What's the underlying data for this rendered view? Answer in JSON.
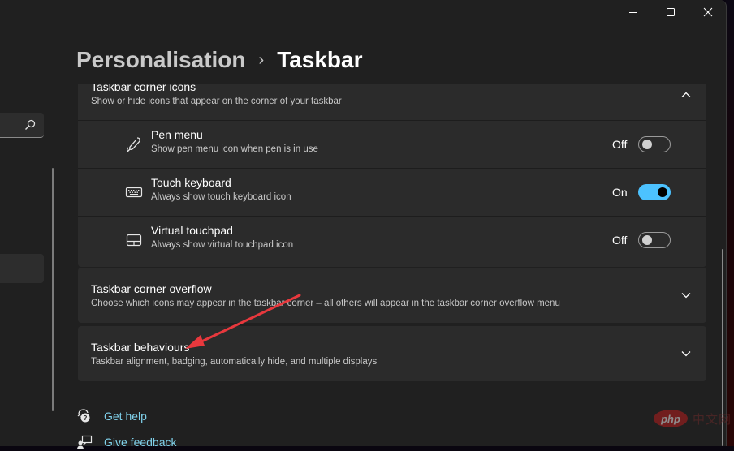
{
  "window": {
    "controls": {
      "minimize": "minimize-icon",
      "maximize": "maximize-icon",
      "close": "close-icon"
    }
  },
  "sidebar": {
    "search_icon": "search-icon"
  },
  "breadcrumb": {
    "parent": "Personalisation",
    "separator": "›",
    "current": "Taskbar"
  },
  "sections": {
    "corner_icons": {
      "title": "Taskbar corner icons",
      "description": "Show or hide icons that appear on the corner of your taskbar",
      "expanded": true,
      "chevron": "chevron-up-icon",
      "items": [
        {
          "icon": "pen-icon",
          "title": "Pen menu",
          "description": "Show pen menu icon when pen is in use",
          "state_label": "Off",
          "on": false
        },
        {
          "icon": "keyboard-icon",
          "title": "Touch keyboard",
          "description": "Always show touch keyboard icon",
          "state_label": "On",
          "on": true
        },
        {
          "icon": "touchpad-icon",
          "title": "Virtual touchpad",
          "description": "Always show virtual touchpad icon",
          "state_label": "Off",
          "on": false
        }
      ]
    },
    "corner_overflow": {
      "title": "Taskbar corner overflow",
      "description": "Choose which icons may appear in the taskbar corner – all others will appear in the taskbar corner overflow menu",
      "expanded": false,
      "chevron": "chevron-down-icon"
    },
    "behaviours": {
      "title": "Taskbar behaviours",
      "description": "Taskbar alignment, badging, automatically hide, and multiple displays",
      "expanded": false,
      "chevron": "chevron-down-icon"
    }
  },
  "links": [
    {
      "icon": "help-icon",
      "label": "Get help"
    },
    {
      "icon": "feedback-icon",
      "label": "Give feedback"
    }
  ],
  "annotation": {
    "arrow_color": "#e8383d",
    "points_to": "Taskbar behaviours"
  },
  "watermark": {
    "logo": "php",
    "text": "中文网"
  },
  "colors": {
    "accent": "#4cc2ff",
    "link": "#7fd0ea",
    "card": "#2b2b2b",
    "background": "#202020"
  }
}
